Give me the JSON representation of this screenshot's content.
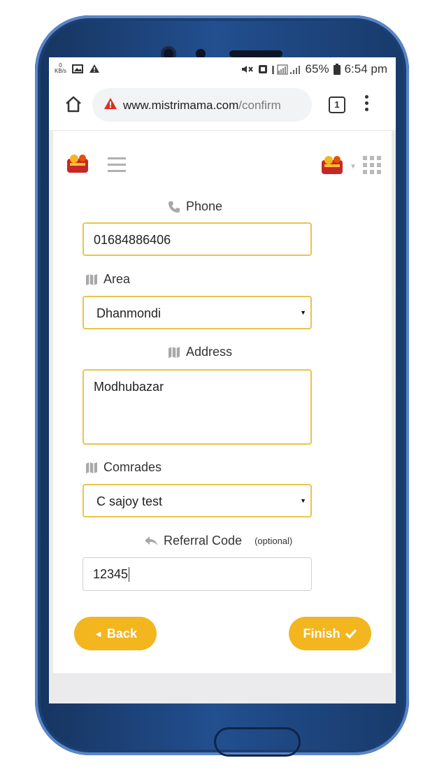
{
  "status_bar": {
    "left_icons": [
      "data-rate-icon",
      "image-icon",
      "warning-icon"
    ],
    "data_rate": "0 KB/s",
    "battery": "65%",
    "time": "6:54 pm"
  },
  "browser": {
    "url_domain": "www.mistrimama.com",
    "url_path": "/confirm",
    "tab_count": "1"
  },
  "form": {
    "phone_label": "Phone",
    "phone_value": "01684886406",
    "area_label": "Area",
    "area_value": "Dhanmondi",
    "address_label": "Address",
    "address_value": "Modhubazar",
    "comrades_label": "Comrades",
    "comrades_value": "C sajoy test",
    "referral_label": "Referral Code",
    "referral_optional": "(optional)",
    "referral_value": "12345"
  },
  "buttons": {
    "back_label": "Back",
    "finish_label": "Finish"
  },
  "colors": {
    "accent": "#f3b61f",
    "field_border": "#e9c54a",
    "phone_body": "#224f8f"
  }
}
